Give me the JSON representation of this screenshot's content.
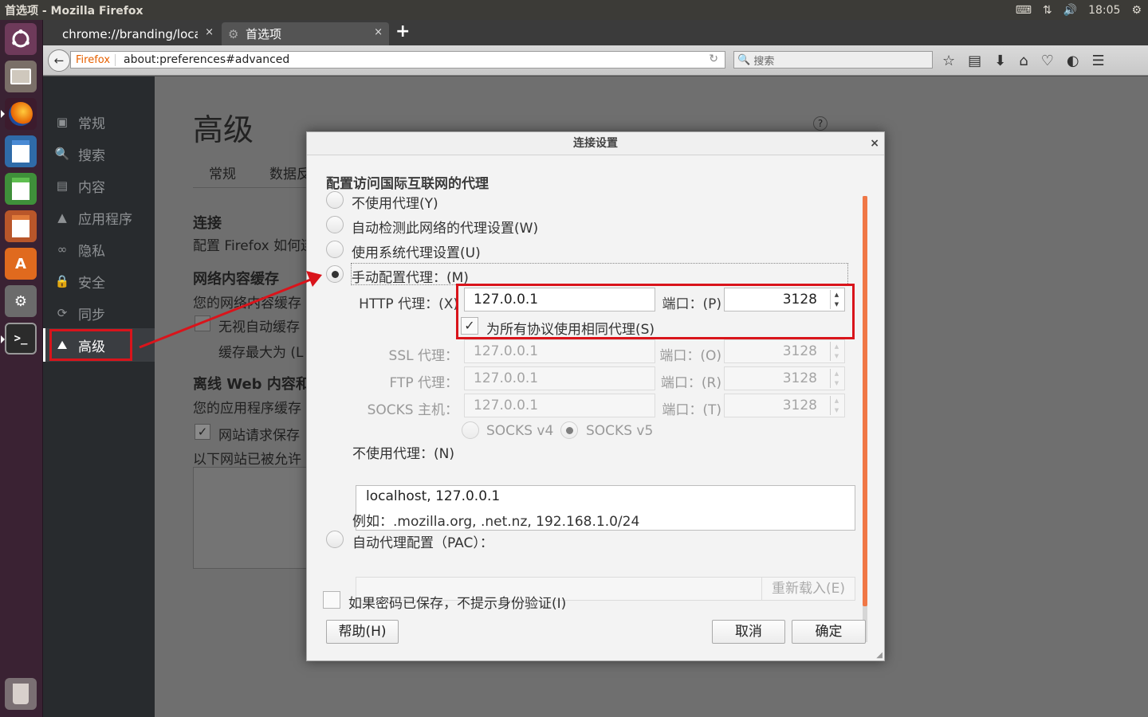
{
  "window": {
    "title": "首选项 - Mozilla Firefox",
    "clock": "18:05"
  },
  "tabs": [
    {
      "label": "chrome://branding/locale",
      "close": "×"
    },
    {
      "label": "首选项",
      "close": "×"
    }
  ],
  "newtab": "+",
  "nav": {
    "identity": "Firefox",
    "url": "about:preferences#advanced",
    "search_placeholder": "搜索"
  },
  "sidebar": {
    "items": [
      {
        "label": "常规"
      },
      {
        "label": "搜索"
      },
      {
        "label": "内容"
      },
      {
        "label": "应用程序"
      },
      {
        "label": "隐私"
      },
      {
        "label": "安全"
      },
      {
        "label": "同步"
      },
      {
        "label": "高级"
      }
    ]
  },
  "main": {
    "heading": "高级",
    "tabs": [
      "常规",
      "数据反"
    ],
    "connection_title": "连接",
    "connection_desc": "配置 Firefox 如何连",
    "cache_title": "网络内容缓存",
    "cache_desc": "您的网络内容缓存",
    "cache_override": "无视自动缓存",
    "cache_limit": "缓存最大为 (L",
    "offline_title": "离线 Web 内容和",
    "offline_desc": "您的应用程序缓存",
    "offline_check": "网站请求保存",
    "offline_allowed": "以下网站已被允许"
  },
  "dialog": {
    "title": "连接设置",
    "close": "×",
    "section": "配置访问国际互联网的代理",
    "options": {
      "none": "不使用代理(Y)",
      "auto_detect": "自动检测此网络的代理设置(W)",
      "system": "使用系统代理设置(U)",
      "manual": "手动配置代理：(M)",
      "pac": "自动代理配置（PAC）："
    },
    "http": {
      "label": "HTTP 代理：(X)",
      "host": "127.0.0.1",
      "port_label": "端口：(P)",
      "port": "3128"
    },
    "same_proxy": "为所有协议使用相同代理(S)",
    "ssl": {
      "label": "SSL 代理：",
      "host": "127.0.0.1",
      "port_label": "端口：(O)",
      "port": "3128"
    },
    "ftp": {
      "label": "FTP 代理：",
      "host": "127.0.0.1",
      "port_label": "端口：(R)",
      "port": "3128"
    },
    "socks": {
      "label": "SOCKS 主机：",
      "host": "127.0.0.1",
      "port_label": "端口：(T)",
      "port": "3128"
    },
    "socks_v4": "SOCKS v4",
    "socks_v5": "SOCKS v5",
    "no_proxy_label": "不使用代理：(N)",
    "no_proxy_value": "localhost, 127.0.0.1",
    "example": "例如：.mozilla.org, .net.nz, 192.168.1.0/24",
    "reload": "重新载入(E)",
    "no_prompt": "如果密码已保存，不提示身份验证(I)",
    "help": "帮助(H)",
    "cancel": "取消",
    "ok": "确定"
  },
  "colors": {
    "annotation": "#d9141b",
    "scroll_thumb": "#f07746",
    "sidebar": "#282b2e"
  }
}
